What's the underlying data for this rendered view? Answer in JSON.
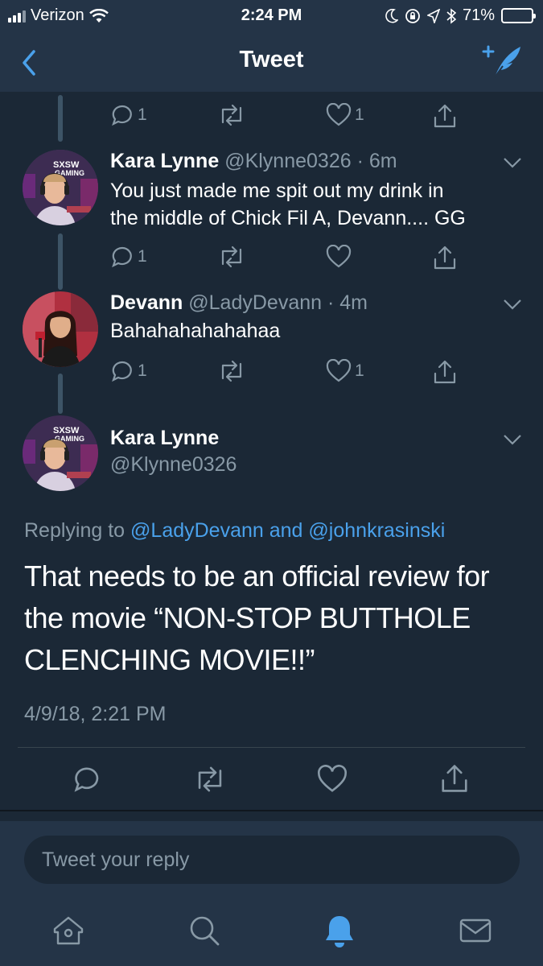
{
  "status": {
    "carrier": "Verizon",
    "time": "2:24 PM",
    "battery": "71%",
    "battery_level": 0.71
  },
  "nav": {
    "title": "Tweet"
  },
  "top_actions": {
    "reply_count": "1",
    "like_count": "1"
  },
  "tweets": [
    {
      "name": "Kara Lynne",
      "handle": "@Klynne0326",
      "time": "6m",
      "text_line1": "You just made me spit out my drink in",
      "text_line2": "the middle of Chick Fil A, Devann.... GG",
      "reply_count": "1",
      "like_count": ""
    },
    {
      "name": "Devann",
      "handle": "@LadyDevann",
      "time": "4m",
      "text_line1": "Bahahahahahahaa",
      "reply_count": "1",
      "like_count": "1"
    }
  ],
  "main": {
    "name": "Kara Lynne",
    "handle": "@Klynne0326",
    "replying_prefix": "Replying to",
    "replying_user1": "@LadyDevann",
    "replying_and": "and",
    "replying_user2": "@johnkrasinski",
    "text_line1": "That needs to be an official review for",
    "text_line2": "the movie “NON-STOP BUTTHOLE",
    "text_line3": "CLENCHING MOVIE!!”",
    "date": "4/9/18, 2:21 PM"
  },
  "reply": {
    "placeholder": "Tweet your reply"
  },
  "colors": {
    "background": "#1b2836",
    "bar": "#243447",
    "accent": "#4aa1eb",
    "muted": "#8899a6"
  },
  "tabs": [
    {
      "icon": "home-icon"
    },
    {
      "icon": "search-icon"
    },
    {
      "icon": "notifications-icon",
      "active": true
    },
    {
      "icon": "messages-icon"
    }
  ]
}
